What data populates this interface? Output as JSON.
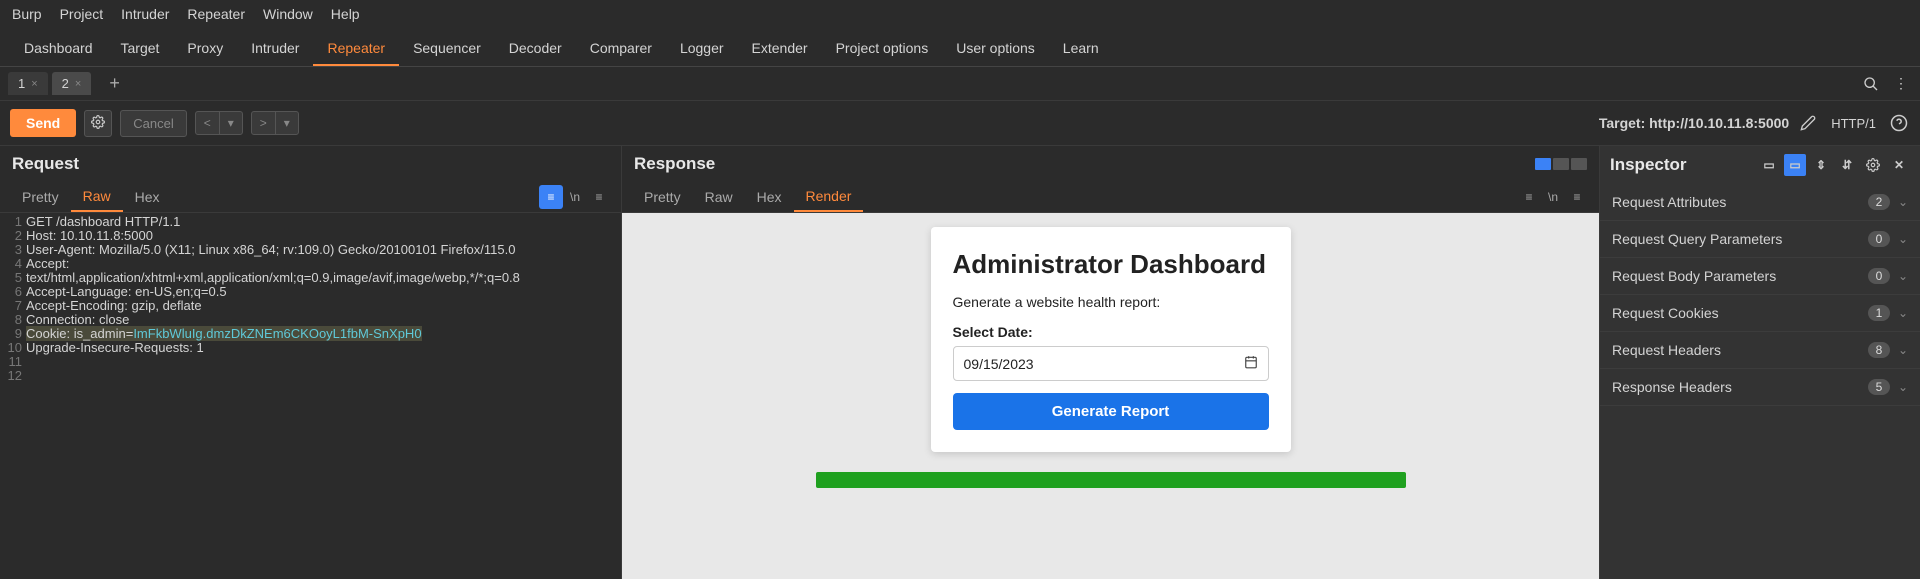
{
  "menubar": [
    "Burp",
    "Project",
    "Intruder",
    "Repeater",
    "Window",
    "Help"
  ],
  "maintabs": [
    "Dashboard",
    "Target",
    "Proxy",
    "Intruder",
    "Repeater",
    "Sequencer",
    "Decoder",
    "Comparer",
    "Logger",
    "Extender",
    "Project options",
    "User options",
    "Learn"
  ],
  "active_maintab": "Repeater",
  "repeater_tabs": [
    {
      "label": "1",
      "active": false
    },
    {
      "label": "2",
      "active": true
    }
  ],
  "action": {
    "send": "Send",
    "cancel": "Cancel"
  },
  "target": "Target: http://10.10.11.8:5000",
  "protocol": "HTTP/1",
  "request": {
    "title": "Request",
    "tabs": [
      "Pretty",
      "Raw",
      "Hex"
    ],
    "active": "Raw",
    "lines": [
      "GET /dashboard HTTP/1.1",
      "Host: 10.10.11.8:5000",
      "User-Agent: Mozilla/5.0 (X11; Linux x86_64; rv:109.0) Gecko/20100101 Firefox/115.0",
      "Accept:",
      "text/html,application/xhtml+xml,application/xml;q=0.9,image/avif,image/webp,*/*;q=0.8",
      "Accept-Language: en-US,en;q=0.5",
      "Accept-Encoding: gzip, deflate",
      "Connection: close",
      "Cookie: is_admin=",
      "Upgrade-Insecure-Requests: 1",
      "",
      ""
    ],
    "cookie_value": "ImFkbWluIg.dmzDkZNEm6CKOoyL1fbM-SnXpH0"
  },
  "response": {
    "title": "Response",
    "tabs": [
      "Pretty",
      "Raw",
      "Hex",
      "Render"
    ],
    "active": "Render",
    "rendered": {
      "heading": "Administrator Dashboard",
      "subtext": "Generate a website health report:",
      "date_label": "Select Date:",
      "date_value": "09/15/2023",
      "button": "Generate Report"
    }
  },
  "inspector": {
    "title": "Inspector",
    "rows": [
      {
        "label": "Request Attributes",
        "count": "2"
      },
      {
        "label": "Request Query Parameters",
        "count": "0"
      },
      {
        "label": "Request Body Parameters",
        "count": "0"
      },
      {
        "label": "Request Cookies",
        "count": "1"
      },
      {
        "label": "Request Headers",
        "count": "8"
      },
      {
        "label": "Response Headers",
        "count": "5"
      }
    ]
  }
}
